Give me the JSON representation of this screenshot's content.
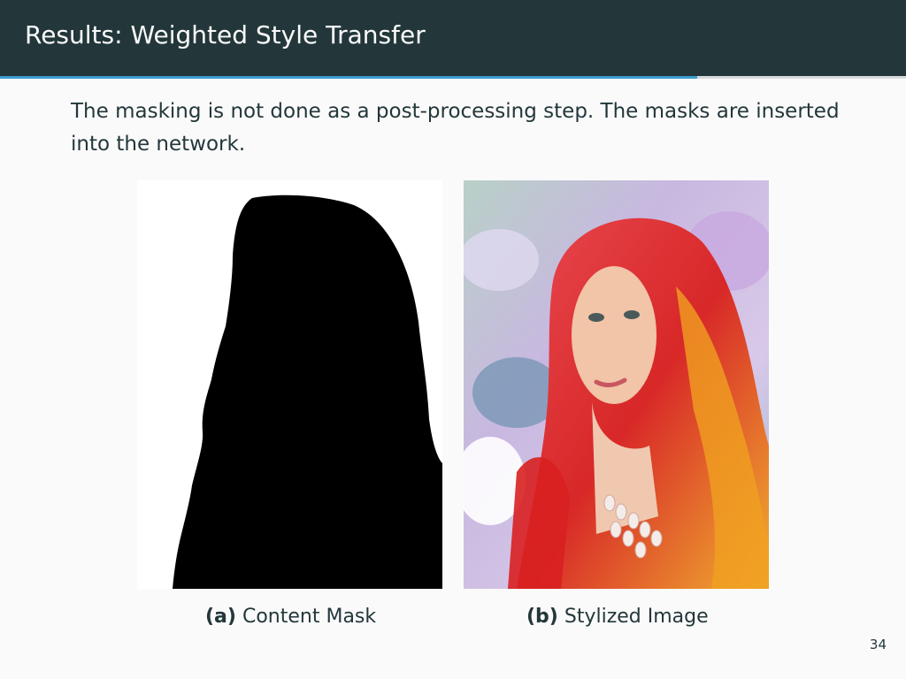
{
  "header": {
    "title": "Results: Weighted Style Transfer"
  },
  "progress": {
    "fraction": 0.77
  },
  "body": {
    "text": "The masking is not done as a post-processing step. The masks are inserted into the network."
  },
  "figures": [
    {
      "label": "(a)",
      "caption": "Content Mask"
    },
    {
      "label": "(b)",
      "caption": "Stylized Image"
    }
  ],
  "page_number": "34",
  "colors": {
    "header_bg": "#23373b",
    "accent": "#3a9bd0",
    "background": "#fafafa"
  }
}
